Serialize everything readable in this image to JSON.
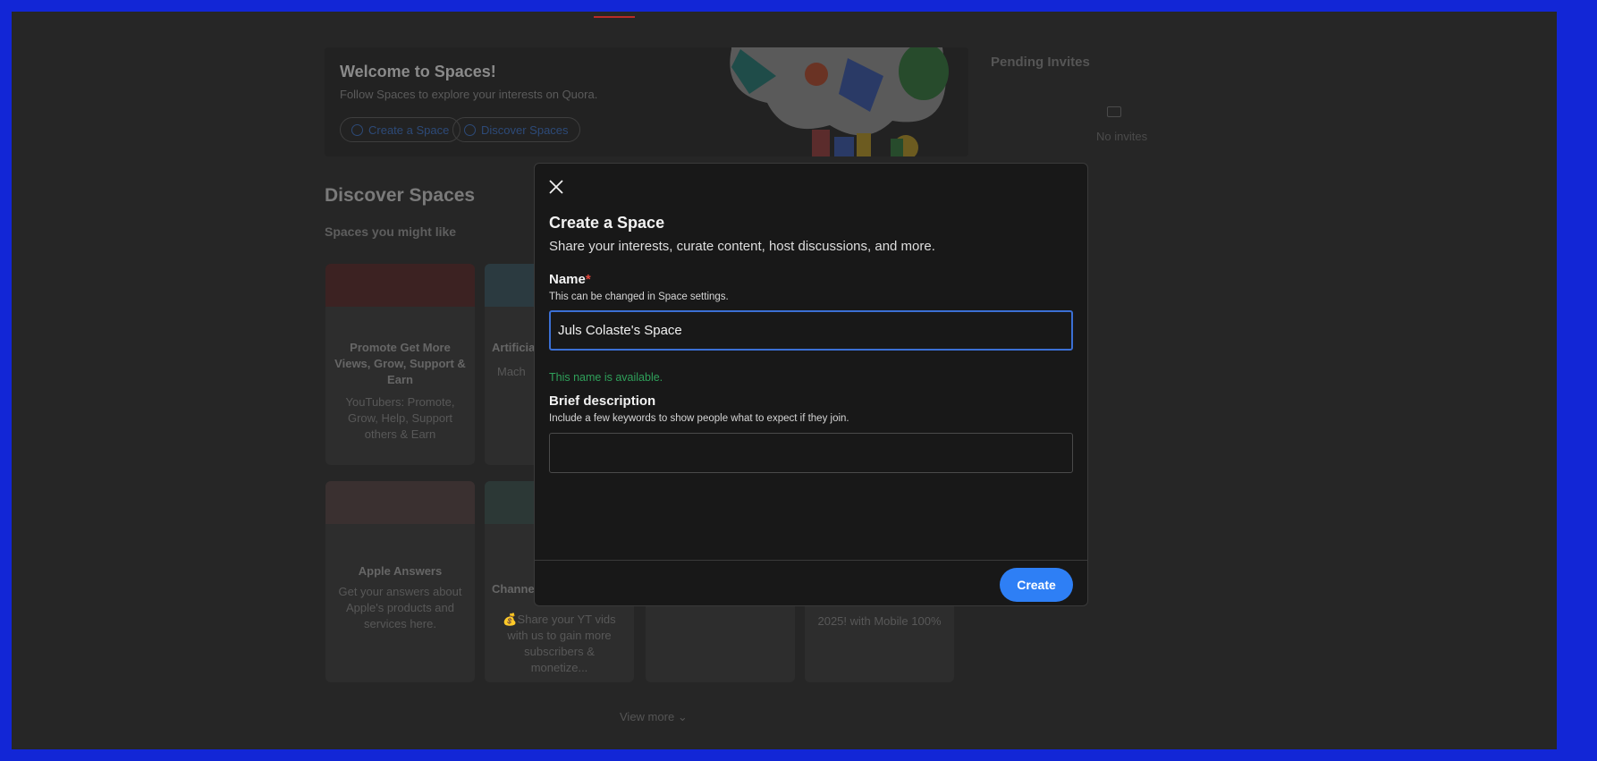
{
  "welcome": {
    "title": "Welcome to Spaces!",
    "subtitle": "Follow Spaces to explore your interests on Quora.",
    "create_space": "Create a Space",
    "discover_spaces": "Discover Spaces"
  },
  "pending": {
    "title": "Pending Invites",
    "empty": "No invites"
  },
  "discover": {
    "title": "Discover Spaces",
    "subtitle": "Spaces you might like",
    "cards": [
      {
        "title": "Promote Get More Views, Grow, Support & Earn",
        "desc": "YouTubers: Promote, Grow, Help, Support others & Earn"
      },
      {
        "title": "Artificia",
        "desc": "Mach"
      },
      {
        "title": "Apple Answers",
        "desc": "Get your answers about Apple's products and services here."
      },
      {
        "title": "Channe",
        "desc": "💰Share your YT vids with us to gain more subscribers & monetize..."
      },
      {
        "title": "",
        "desc": ""
      },
      {
        "title": "",
        "desc": "2025! with Mobile 100%"
      }
    ],
    "view_more": "View more"
  },
  "modal": {
    "title": "Create a Space",
    "subtitle": "Share your interests, curate content, host discussions, and more.",
    "name_label": "Name",
    "required_mark": "*",
    "name_hint": "This can be changed in Space settings.",
    "name_value": "Juls Colaste's Space",
    "name_status": "This name is available.",
    "desc_label": "Brief description",
    "desc_hint": "Include a few keywords to show people what to expect if they join.",
    "desc_value": "",
    "create_button": "Create"
  },
  "colors": {
    "accent": "#2e7ff5",
    "success": "#2fa05a",
    "required": "#e0463c",
    "frame": "#1226d6"
  }
}
